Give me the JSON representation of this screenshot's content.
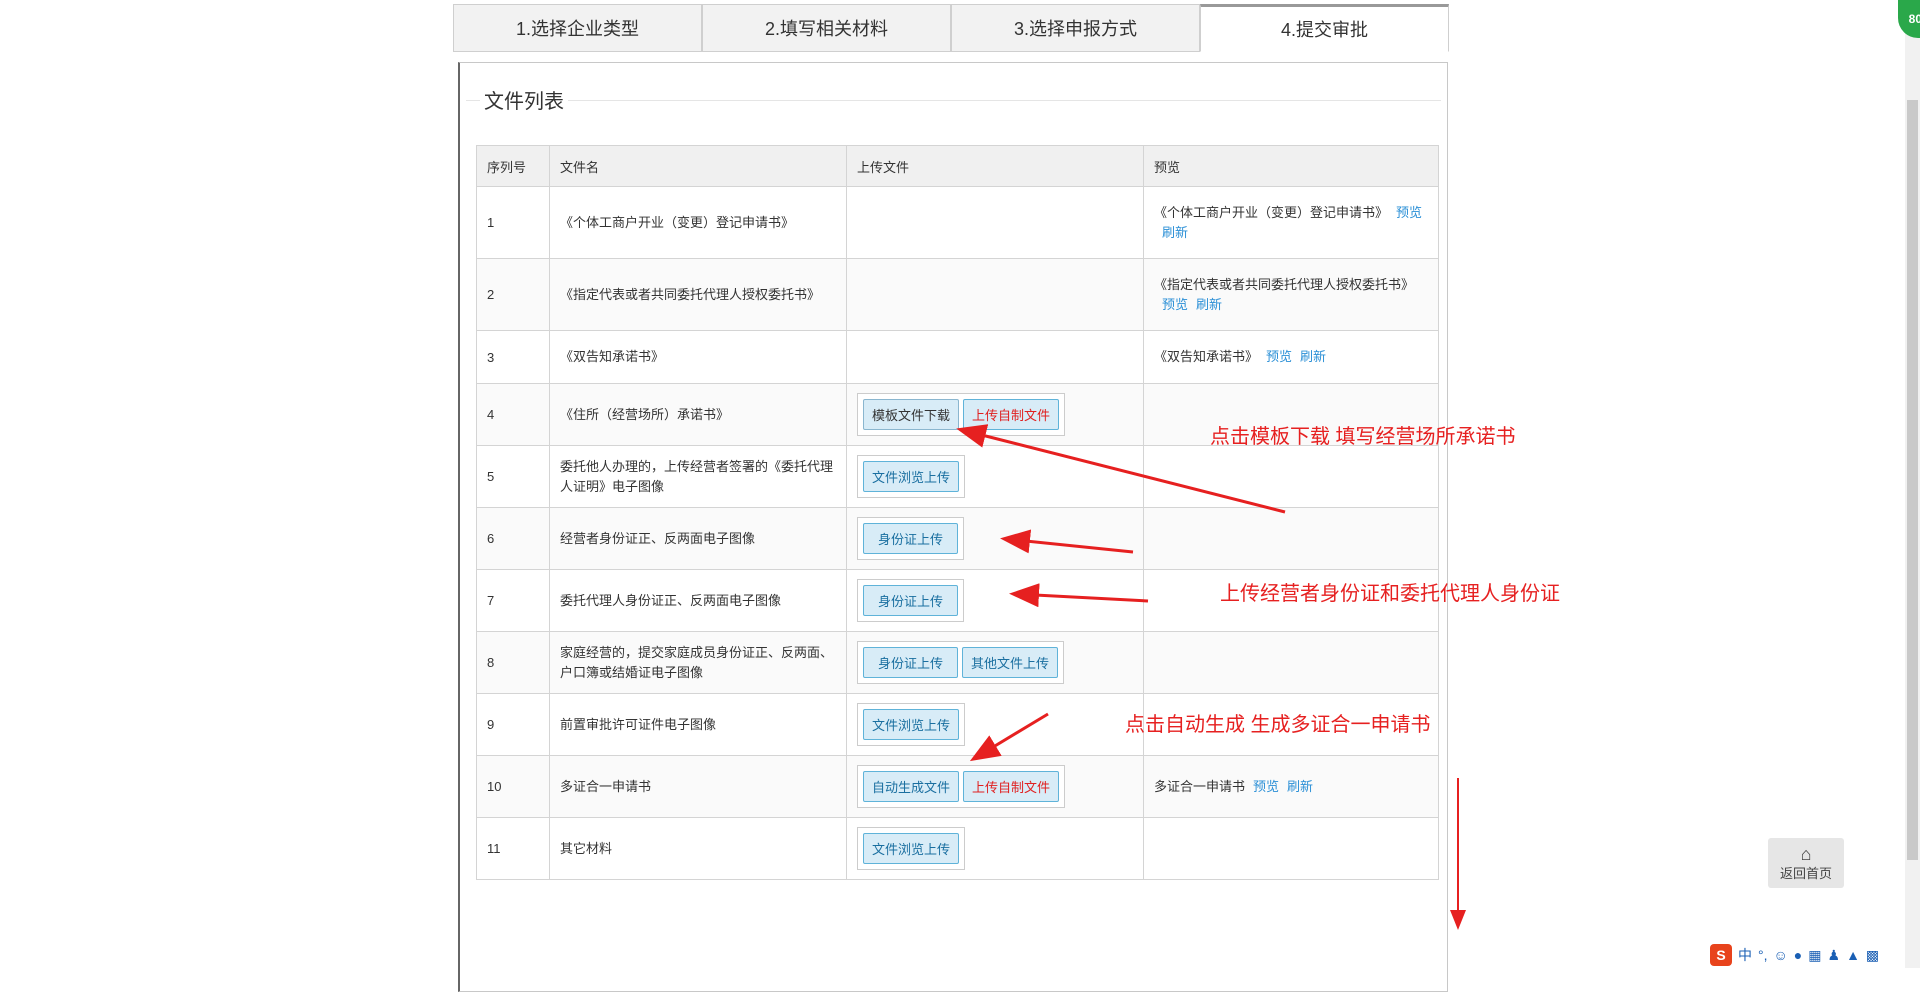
{
  "tabs": [
    "1.选择企业类型",
    "2.填写相关材料",
    "3.选择申报方式",
    "4.提交审批"
  ],
  "panel": {
    "legend": "文件列表"
  },
  "table": {
    "headers": [
      "序列号",
      "文件名",
      "上传文件",
      "预览"
    ],
    "rows": [
      {
        "idx": "1",
        "name": "《个体工商户开业（变更）登记申请书》",
        "preview": "《个体工商户开业（变更）登记申请书》",
        "preview_link": "预览",
        "refresh_link": "刷新"
      },
      {
        "idx": "2",
        "name": "《指定代表或者共同委托代理人授权委托书》",
        "preview": "《指定代表或者共同委托代理人授权委托书》",
        "preview_link": "预览",
        "refresh_link": "刷新"
      },
      {
        "idx": "3",
        "name": "《双告知承诺书》",
        "preview": "《双告知承诺书》",
        "preview_link": "预览",
        "refresh_link": "刷新"
      },
      {
        "idx": "4",
        "name": "《住所（经营场所）承诺书》",
        "btn1": "模板文件下载",
        "btn2": "上传自制文件"
      },
      {
        "idx": "5",
        "name": "委托他人办理的，上传经营者签署的《委托代理人证明》电子图像",
        "btn1": "文件浏览上传"
      },
      {
        "idx": "6",
        "name": "经营者身份证正、反两面电子图像",
        "btn1": "身份证上传"
      },
      {
        "idx": "7",
        "name": "委托代理人身份证正、反两面电子图像",
        "btn1": "身份证上传"
      },
      {
        "idx": "8",
        "name": "家庭经营的，提交家庭成员身份证正、反两面、户口簿或结婚证电子图像",
        "btn1": "身份证上传",
        "btn2": "其他文件上传"
      },
      {
        "idx": "9",
        "name": "前置审批许可证件电子图像",
        "btn1": "文件浏览上传"
      },
      {
        "idx": "10",
        "name": "多证合一申请书",
        "btn1": "自动生成文件",
        "btn2": "上传自制文件",
        "preview": "多证合一申请书",
        "preview_link": "预览",
        "refresh_link": "刷新"
      },
      {
        "idx": "11",
        "name": "其它材料",
        "btn1": "文件浏览上传"
      }
    ]
  },
  "annotations": {
    "a1": "点击模板下载 填写经营场所承诺书",
    "a2": "上传经营者身份证和委托代理人身份证",
    "a3": "点击自动生成 生成多证合一申请书"
  },
  "home_button": "返回首页",
  "badge": "80",
  "ime": {
    "logo": "S",
    "lang": "中"
  },
  "colors": {
    "annotation": "#e62020",
    "link": "#2a8fd6",
    "button_bg": "#d8ecf7"
  }
}
